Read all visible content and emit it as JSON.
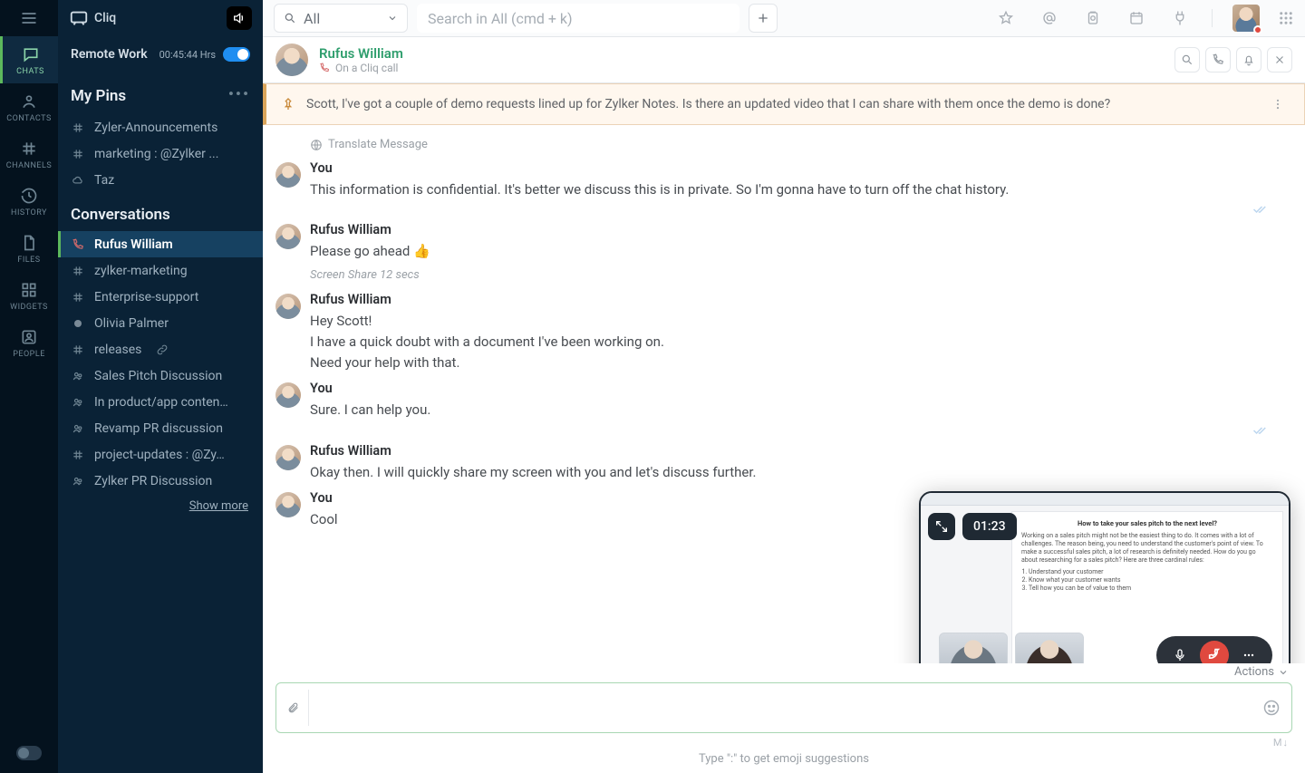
{
  "brand": "Cliq",
  "remote": {
    "label": "Remote Work",
    "timer": "00:45:44 Hrs"
  },
  "rail": [
    {
      "label": "CHATS",
      "icon": "chat-icon",
      "active": true
    },
    {
      "label": "CONTACTS",
      "icon": "contacts-icon"
    },
    {
      "label": "CHANNELS",
      "icon": "channels-icon"
    },
    {
      "label": "HISTORY",
      "icon": "history-icon"
    },
    {
      "label": "FILES",
      "icon": "files-icon"
    },
    {
      "label": "WIDGETS",
      "icon": "widgets-icon"
    },
    {
      "label": "PEOPLE",
      "icon": "people-icon"
    }
  ],
  "pins": {
    "title": "My Pins",
    "items": [
      {
        "icon": "hash",
        "label": "Zyler-Announcements"
      },
      {
        "icon": "hash",
        "label": "marketing : @Zylker ..."
      },
      {
        "icon": "cloud",
        "label": "Taz"
      }
    ]
  },
  "convs": {
    "title": "Conversations",
    "items": [
      {
        "icon": "call",
        "label": "Rufus William",
        "selected": true
      },
      {
        "icon": "hash",
        "label": "zylker-marketing"
      },
      {
        "icon": "hash",
        "label": "Enterprise-support"
      },
      {
        "icon": "presence",
        "label": "Olivia Palmer"
      },
      {
        "icon": "hash",
        "label": "releases",
        "extra": "link"
      },
      {
        "icon": "group",
        "label": "Sales Pitch Discussion"
      },
      {
        "icon": "group",
        "label": "In product/app conten…"
      },
      {
        "icon": "group",
        "label": "Revamp PR discussion"
      },
      {
        "icon": "hash",
        "label": "project-updates : @Zy…"
      },
      {
        "icon": "group",
        "label": "Zylker PR Discussion"
      }
    ],
    "show_more": "Show more"
  },
  "topbar": {
    "scope": "All",
    "search_placeholder": "Search in All (cmd + k)"
  },
  "conv_header": {
    "name": "Rufus William",
    "status": "On a Cliq call"
  },
  "banner": "Scott, I've got a couple of demo requests lined up for Zylker Notes. Is there an updated video that I can share with them once the demo is done?",
  "translate": "Translate Message",
  "messages": [
    {
      "who": "You",
      "lines": [
        "This information is confidential. It's better we discuss this is in private. So I'm gonna have to turn off the chat history."
      ],
      "read": true
    },
    {
      "who": "Rufus William",
      "lines": [
        "Please go ahead   👍"
      ],
      "meta": "Screen Share  12 secs"
    },
    {
      "who": "Rufus William",
      "lines": [
        "Hey Scott!",
        "I have a quick doubt with a document I've been working on.",
        "Need your help with that."
      ]
    },
    {
      "who": "You",
      "lines": [
        "Sure. I can help you."
      ],
      "read": true
    },
    {
      "who": "Rufus William",
      "lines": [
        "Okay then. I will quickly share my screen with you and let's discuss further."
      ]
    },
    {
      "who": "You",
      "lines": [
        "Cool"
      ],
      "read": true
    }
  ],
  "call": {
    "timer": "01:23",
    "doc_title": "How to take your sales pitch to the next level?",
    "doc_body": "Working on a sales pitch might not be the easiest thing to do. It comes with a lot of challenges. The reason being, you need to understand the customer's point of view. To make a successful sales pitch, a lot of research is definitely needed. How do you go about researching for a sales pitch? Here are three cardinal rules:",
    "doc_list": [
      "Understand your customer",
      "Know what your customer wants",
      "Tell how you can be of value to them"
    ]
  },
  "footer": {
    "actions": "Actions",
    "hint": "Type \":\" to get emoji suggestions",
    "md": "M↓"
  }
}
